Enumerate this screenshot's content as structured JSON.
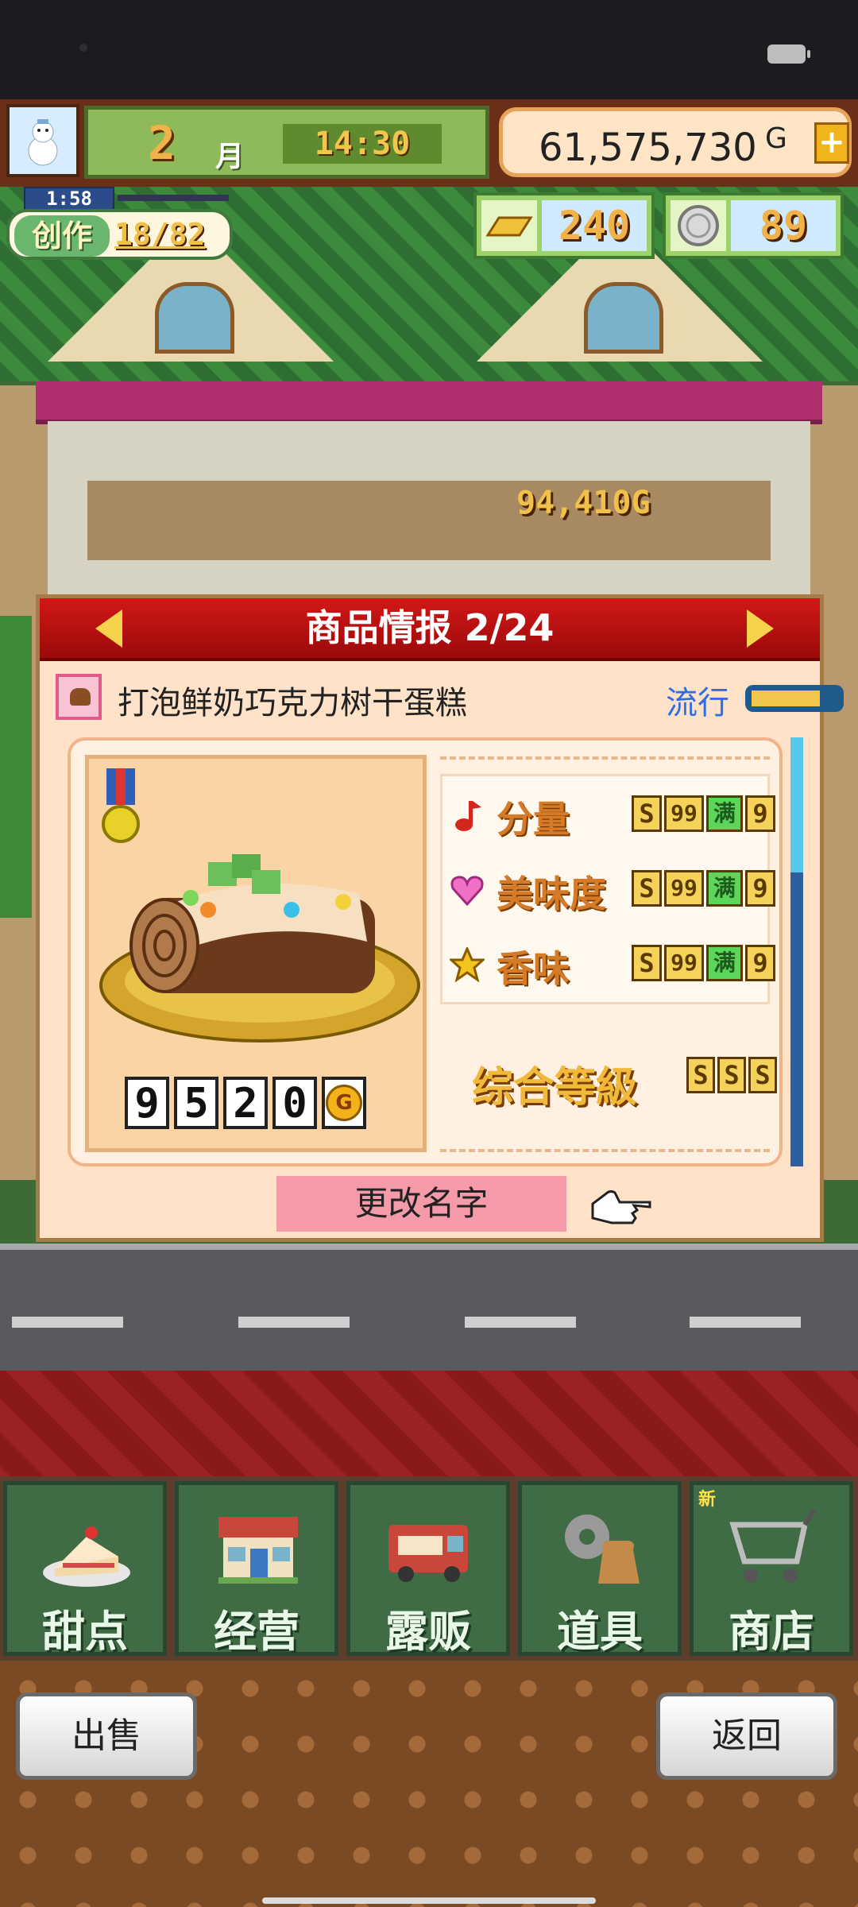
{
  "hud": {
    "month_number": "2",
    "month_label": "月",
    "time": "14:30",
    "money": "61,575,730",
    "money_unit": "G",
    "plus_label": "+"
  },
  "craft": {
    "timer": "1:58",
    "label": "创作",
    "count": "18/82"
  },
  "resources": {
    "gold_bars": "240",
    "coins": "89"
  },
  "scene": {
    "sales_popup": "94,410G"
  },
  "panel": {
    "title": "商品情报 2/24",
    "item_name": "打泡鲜奶巧克力树干蛋糕",
    "trend_label": "流行",
    "trend_level": 0.8,
    "price_digits": [
      "9",
      "5",
      "2",
      "0"
    ],
    "price_unit": "G",
    "stats": [
      {
        "label": "分量",
        "icon": "music-note-icon",
        "rank": "S",
        "value_a": "99",
        "full_label": "满",
        "value_b": "9"
      },
      {
        "label": "美味度",
        "icon": "heart-icon",
        "rank": "S",
        "value_a": "99",
        "full_label": "满",
        "value_b": "9"
      },
      {
        "label": "香味",
        "icon": "star-icon",
        "rank": "S",
        "value_a": "99",
        "full_label": "满",
        "value_b": "9"
      }
    ],
    "overall_label": "综合等級",
    "overall_rank": [
      "S",
      "S",
      "S"
    ],
    "rename_label": "更改名字"
  },
  "nav": {
    "items": [
      {
        "label": "甜点",
        "icon": "cake-icon"
      },
      {
        "label": "经营",
        "icon": "shop-building-icon"
      },
      {
        "label": "露贩",
        "icon": "food-truck-icon"
      },
      {
        "label": "道具",
        "icon": "gear-bag-icon"
      },
      {
        "label": "商店",
        "icon": "cart-icon",
        "badge": "新"
      }
    ]
  },
  "buttons": {
    "sell": "出售",
    "back": "返回"
  },
  "colors": {
    "panel_header": "#c41212",
    "trend_text": "#2d6ee6",
    "rename_button": "#f59aa8",
    "nav_tile": "#3f6b45"
  }
}
